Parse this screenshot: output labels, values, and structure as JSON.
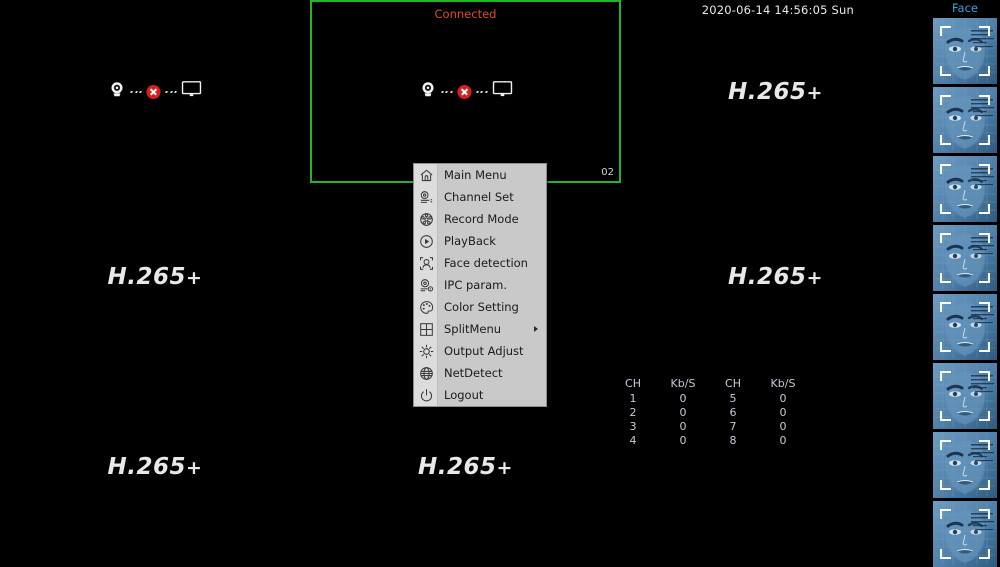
{
  "datetime": "2020-06-14 14:56:05 Sun",
  "wall": {
    "cells": [
      {
        "id": "cell-1",
        "row": 0,
        "col": 0,
        "content": "link-status",
        "selected": false,
        "channel": "",
        "status": ""
      },
      {
        "id": "cell-2",
        "row": 0,
        "col": 1,
        "content": "link-status",
        "selected": true,
        "channel": "02",
        "status": "Connected"
      },
      {
        "id": "cell-3",
        "row": 0,
        "col": 2,
        "content": "h265",
        "selected": false,
        "channel": "",
        "status": ""
      },
      {
        "id": "cell-4",
        "row": 1,
        "col": 0,
        "content": "h265",
        "selected": false,
        "channel": "",
        "status": ""
      },
      {
        "id": "cell-5",
        "row": 1,
        "col": 1,
        "content": "blank",
        "selected": false,
        "channel": "",
        "status": ""
      },
      {
        "id": "cell-6",
        "row": 1,
        "col": 2,
        "content": "h265",
        "selected": false,
        "channel": "",
        "status": ""
      },
      {
        "id": "cell-7",
        "row": 2,
        "col": 0,
        "content": "h265",
        "selected": false,
        "channel": "",
        "status": ""
      },
      {
        "id": "cell-8",
        "row": 2,
        "col": 1,
        "content": "h265",
        "selected": false,
        "channel": "",
        "status": ""
      },
      {
        "id": "cell-9",
        "row": 2,
        "col": 2,
        "content": "net-stats",
        "selected": false,
        "channel": "",
        "status": ""
      }
    ],
    "codec_label": "H.265",
    "codec_plus": "+",
    "selection_color": "#23b22a",
    "connected_color": "#e04a2a"
  },
  "net_stats": {
    "headers": [
      "CH",
      "Kb/S",
      "CH",
      "Kb/S"
    ],
    "rows": [
      [
        "1",
        "0",
        "5",
        "0"
      ],
      [
        "2",
        "0",
        "6",
        "0"
      ],
      [
        "3",
        "0",
        "7",
        "0"
      ],
      [
        "4",
        "0",
        "8",
        "0"
      ]
    ]
  },
  "face_panel": {
    "title": "Face",
    "title_color": "#2fa8dd",
    "thumbnail_count": 8
  },
  "context_menu": {
    "items": [
      {
        "label": "Main Menu",
        "icon": "home-icon",
        "submenu": false
      },
      {
        "label": "Channel Set",
        "icon": "channel-set-icon",
        "submenu": false
      },
      {
        "label": "Record Mode",
        "icon": "record-mode-icon",
        "submenu": false
      },
      {
        "label": "PlayBack",
        "icon": "playback-icon",
        "submenu": false
      },
      {
        "label": "Face detection",
        "icon": "face-detection-icon",
        "submenu": false
      },
      {
        "label": "IPC param.",
        "icon": "ipc-param-icon",
        "submenu": false
      },
      {
        "label": "Color Setting",
        "icon": "color-setting-icon",
        "submenu": false
      },
      {
        "label": "SplitMenu",
        "icon": "split-menu-icon",
        "submenu": true
      },
      {
        "label": "Output Adjust",
        "icon": "output-adjust-icon",
        "submenu": false
      },
      {
        "label": "NetDetect",
        "icon": "net-detect-icon",
        "submenu": false
      },
      {
        "label": "Logout",
        "icon": "logout-icon",
        "submenu": false
      }
    ]
  }
}
